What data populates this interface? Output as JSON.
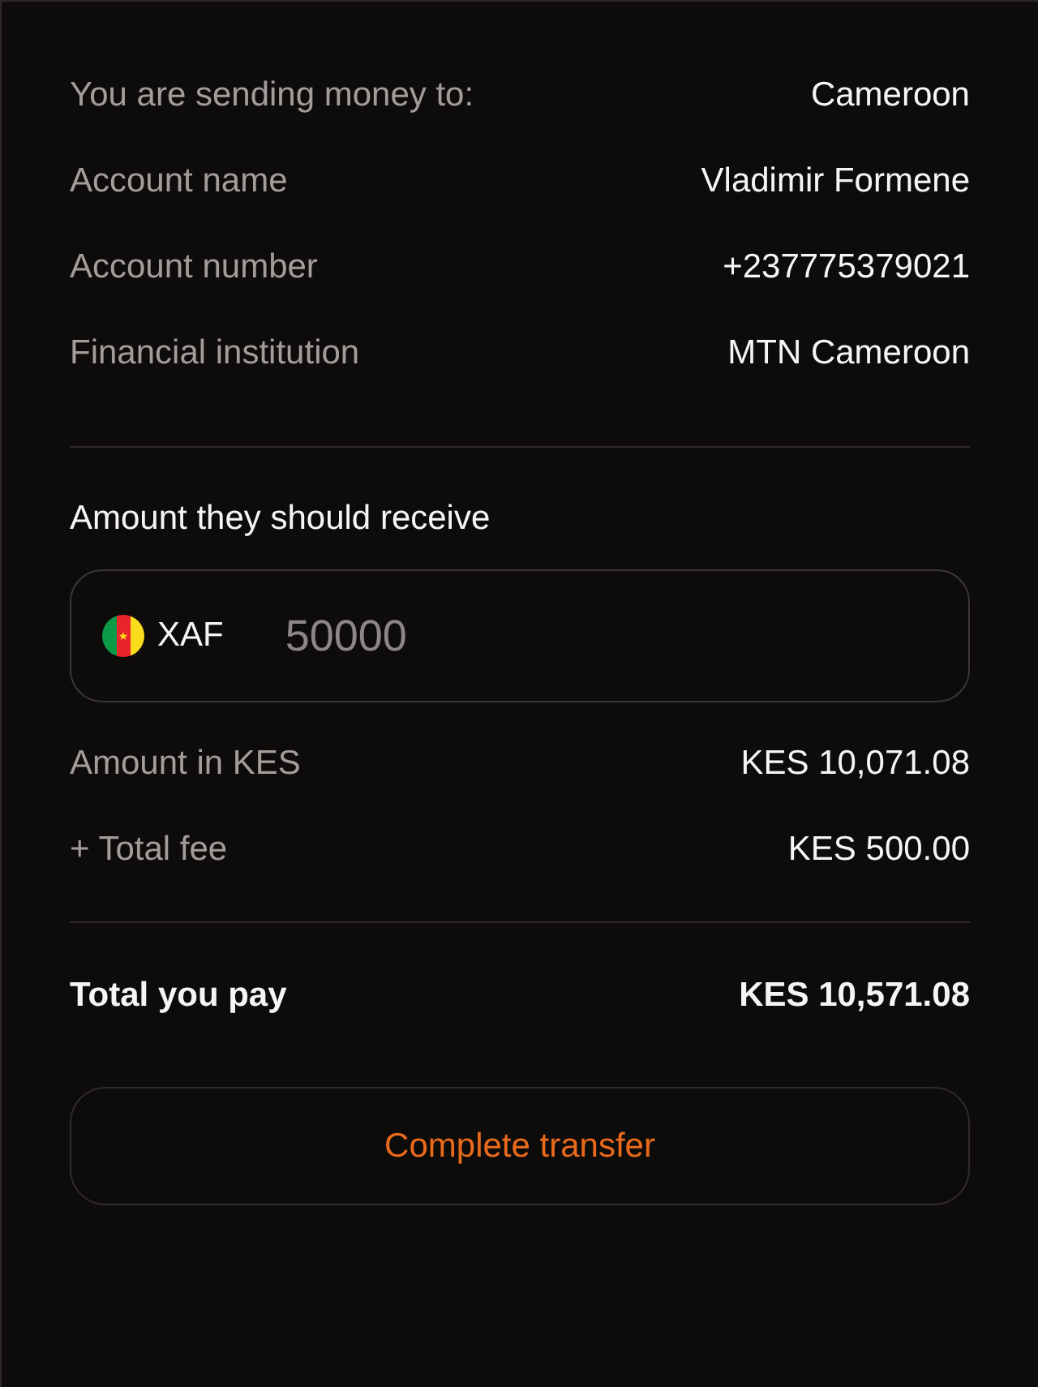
{
  "details": [
    {
      "label": "You are sending money to:",
      "value": "Cameroon"
    },
    {
      "label": "Account name",
      "value": "Vladimir Formene"
    },
    {
      "label": "Account number",
      "value": "+237775379021"
    },
    {
      "label": "Financial institution",
      "value": "MTN Cameroon"
    }
  ],
  "amount": {
    "label": "Amount they should receive",
    "currency": "XAF",
    "value": "50000"
  },
  "breakdown": [
    {
      "label": "Amount in KES",
      "value": "KES 10,071.08"
    },
    {
      "label": "+ Total fee",
      "value": "KES 500.00"
    }
  ],
  "total": {
    "label": "Total you pay",
    "value": "KES 10,571.08"
  },
  "button": {
    "label": "Complete transfer"
  }
}
